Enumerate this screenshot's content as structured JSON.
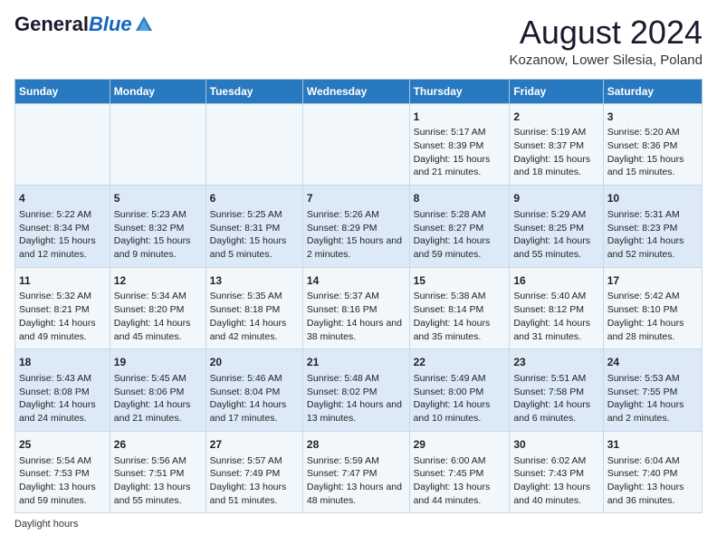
{
  "header": {
    "logo_general": "General",
    "logo_blue": "Blue",
    "month_title": "August 2024",
    "location": "Kozanow, Lower Silesia, Poland"
  },
  "days_of_week": [
    "Sunday",
    "Monday",
    "Tuesday",
    "Wednesday",
    "Thursday",
    "Friday",
    "Saturday"
  ],
  "weeks": [
    [
      {
        "day": "",
        "sunrise": "",
        "sunset": "",
        "daylight": ""
      },
      {
        "day": "",
        "sunrise": "",
        "sunset": "",
        "daylight": ""
      },
      {
        "day": "",
        "sunrise": "",
        "sunset": "",
        "daylight": ""
      },
      {
        "day": "",
        "sunrise": "",
        "sunset": "",
        "daylight": ""
      },
      {
        "day": "1",
        "sunrise": "Sunrise: 5:17 AM",
        "sunset": "Sunset: 8:39 PM",
        "daylight": "Daylight: 15 hours and 21 minutes."
      },
      {
        "day": "2",
        "sunrise": "Sunrise: 5:19 AM",
        "sunset": "Sunset: 8:37 PM",
        "daylight": "Daylight: 15 hours and 18 minutes."
      },
      {
        "day": "3",
        "sunrise": "Sunrise: 5:20 AM",
        "sunset": "Sunset: 8:36 PM",
        "daylight": "Daylight: 15 hours and 15 minutes."
      }
    ],
    [
      {
        "day": "4",
        "sunrise": "Sunrise: 5:22 AM",
        "sunset": "Sunset: 8:34 PM",
        "daylight": "Daylight: 15 hours and 12 minutes."
      },
      {
        "day": "5",
        "sunrise": "Sunrise: 5:23 AM",
        "sunset": "Sunset: 8:32 PM",
        "daylight": "Daylight: 15 hours and 9 minutes."
      },
      {
        "day": "6",
        "sunrise": "Sunrise: 5:25 AM",
        "sunset": "Sunset: 8:31 PM",
        "daylight": "Daylight: 15 hours and 5 minutes."
      },
      {
        "day": "7",
        "sunrise": "Sunrise: 5:26 AM",
        "sunset": "Sunset: 8:29 PM",
        "daylight": "Daylight: 15 hours and 2 minutes."
      },
      {
        "day": "8",
        "sunrise": "Sunrise: 5:28 AM",
        "sunset": "Sunset: 8:27 PM",
        "daylight": "Daylight: 14 hours and 59 minutes."
      },
      {
        "day": "9",
        "sunrise": "Sunrise: 5:29 AM",
        "sunset": "Sunset: 8:25 PM",
        "daylight": "Daylight: 14 hours and 55 minutes."
      },
      {
        "day": "10",
        "sunrise": "Sunrise: 5:31 AM",
        "sunset": "Sunset: 8:23 PM",
        "daylight": "Daylight: 14 hours and 52 minutes."
      }
    ],
    [
      {
        "day": "11",
        "sunrise": "Sunrise: 5:32 AM",
        "sunset": "Sunset: 8:21 PM",
        "daylight": "Daylight: 14 hours and 49 minutes."
      },
      {
        "day": "12",
        "sunrise": "Sunrise: 5:34 AM",
        "sunset": "Sunset: 8:20 PM",
        "daylight": "Daylight: 14 hours and 45 minutes."
      },
      {
        "day": "13",
        "sunrise": "Sunrise: 5:35 AM",
        "sunset": "Sunset: 8:18 PM",
        "daylight": "Daylight: 14 hours and 42 minutes."
      },
      {
        "day": "14",
        "sunrise": "Sunrise: 5:37 AM",
        "sunset": "Sunset: 8:16 PM",
        "daylight": "Daylight: 14 hours and 38 minutes."
      },
      {
        "day": "15",
        "sunrise": "Sunrise: 5:38 AM",
        "sunset": "Sunset: 8:14 PM",
        "daylight": "Daylight: 14 hours and 35 minutes."
      },
      {
        "day": "16",
        "sunrise": "Sunrise: 5:40 AM",
        "sunset": "Sunset: 8:12 PM",
        "daylight": "Daylight: 14 hours and 31 minutes."
      },
      {
        "day": "17",
        "sunrise": "Sunrise: 5:42 AM",
        "sunset": "Sunset: 8:10 PM",
        "daylight": "Daylight: 14 hours and 28 minutes."
      }
    ],
    [
      {
        "day": "18",
        "sunrise": "Sunrise: 5:43 AM",
        "sunset": "Sunset: 8:08 PM",
        "daylight": "Daylight: 14 hours and 24 minutes."
      },
      {
        "day": "19",
        "sunrise": "Sunrise: 5:45 AM",
        "sunset": "Sunset: 8:06 PM",
        "daylight": "Daylight: 14 hours and 21 minutes."
      },
      {
        "day": "20",
        "sunrise": "Sunrise: 5:46 AM",
        "sunset": "Sunset: 8:04 PM",
        "daylight": "Daylight: 14 hours and 17 minutes."
      },
      {
        "day": "21",
        "sunrise": "Sunrise: 5:48 AM",
        "sunset": "Sunset: 8:02 PM",
        "daylight": "Daylight: 14 hours and 13 minutes."
      },
      {
        "day": "22",
        "sunrise": "Sunrise: 5:49 AM",
        "sunset": "Sunset: 8:00 PM",
        "daylight": "Daylight: 14 hours and 10 minutes."
      },
      {
        "day": "23",
        "sunrise": "Sunrise: 5:51 AM",
        "sunset": "Sunset: 7:58 PM",
        "daylight": "Daylight: 14 hours and 6 minutes."
      },
      {
        "day": "24",
        "sunrise": "Sunrise: 5:53 AM",
        "sunset": "Sunset: 7:55 PM",
        "daylight": "Daylight: 14 hours and 2 minutes."
      }
    ],
    [
      {
        "day": "25",
        "sunrise": "Sunrise: 5:54 AM",
        "sunset": "Sunset: 7:53 PM",
        "daylight": "Daylight: 13 hours and 59 minutes."
      },
      {
        "day": "26",
        "sunrise": "Sunrise: 5:56 AM",
        "sunset": "Sunset: 7:51 PM",
        "daylight": "Daylight: 13 hours and 55 minutes."
      },
      {
        "day": "27",
        "sunrise": "Sunrise: 5:57 AM",
        "sunset": "Sunset: 7:49 PM",
        "daylight": "Daylight: 13 hours and 51 minutes."
      },
      {
        "day": "28",
        "sunrise": "Sunrise: 5:59 AM",
        "sunset": "Sunset: 7:47 PM",
        "daylight": "Daylight: 13 hours and 48 minutes."
      },
      {
        "day": "29",
        "sunrise": "Sunrise: 6:00 AM",
        "sunset": "Sunset: 7:45 PM",
        "daylight": "Daylight: 13 hours and 44 minutes."
      },
      {
        "day": "30",
        "sunrise": "Sunrise: 6:02 AM",
        "sunset": "Sunset: 7:43 PM",
        "daylight": "Daylight: 13 hours and 40 minutes."
      },
      {
        "day": "31",
        "sunrise": "Sunrise: 6:04 AM",
        "sunset": "Sunset: 7:40 PM",
        "daylight": "Daylight: 13 hours and 36 minutes."
      }
    ]
  ],
  "footer": "Daylight hours"
}
